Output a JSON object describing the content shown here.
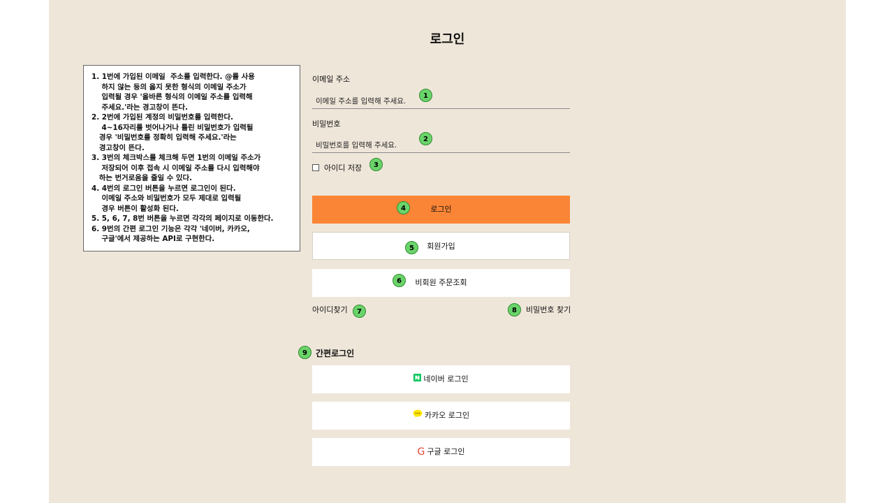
{
  "page": {
    "title": "로그인"
  },
  "notes": [
    "1. 1번에 가입된 이메일  주소를 입력한다. @를 사용",
    "    하지 않는 등의 옳지 못한 형식의 이메일 주소가",
    "    입력될 경우 '올바른 형식의 이메일 주소를 입력해",
    "    주세요.'라는 경고창이 뜬다.",
    "2. 2번에 가입된 계정의 비밀번호를 입력한다.",
    "    4~16자리를 벗어나거나 틀린 비밀번호가 입력될",
    "   경우 '비밀번호를 정확히 입력해 주세요.'라는",
    "   경고창이 뜬다.",
    "3. 3번의 체크박스를 체크해 두면 1번의 이메일 주소가",
    "    저장되어 이후 접속 시 이메일 주소를 다시 입력해야",
    "   하는 번거로움을 줄일 수 있다.",
    "4. 4번의 로그인 버튼을 누르면 로그인이 된다.",
    "    이메일 주소와 비밀번호가 모두 제대로 입력될",
    "    경우 버튼이 활성화 된다.",
    "5. 5, 6, 7, 8번 버튼을 누르면 각각의 페이지로 이동한다.",
    "6. 9번의 간편 로그인 기능은 각각 '네이버, 카카오,",
    "    구글'에서 제공하는 API로 구현한다."
  ],
  "form": {
    "email_label": "이메일 주소",
    "email_placeholder": "이메일 주소를 입력해 주세요.",
    "password_label": "비밀번호",
    "password_placeholder": "비밀번호를 입력해 주세요.",
    "remember_label": "아이디 저장"
  },
  "buttons": {
    "login": "로그인",
    "signup": "회원가입",
    "guest_order": "비회원 주문조회"
  },
  "links": {
    "find_id": "아이디찾기",
    "find_password": "비밀번호 찾기"
  },
  "social": {
    "section_title": "간편로그인",
    "naver": "네이버 로그인",
    "kakao": "카카오 로그인",
    "google": "구글 로그인"
  },
  "badges": [
    "1",
    "2",
    "3",
    "4",
    "5",
    "6",
    "7",
    "8",
    "9"
  ],
  "colors": {
    "page_bg": "#efe6da",
    "login_button": "#fb8536",
    "badge": "#6ad46a",
    "naver": "#03c75a",
    "kakao": "#fee500",
    "google": "#ea4335"
  },
  "icons": {
    "naver": "naver-n-icon",
    "kakao": "kakao-bubble-icon",
    "google": "google-g-icon"
  }
}
